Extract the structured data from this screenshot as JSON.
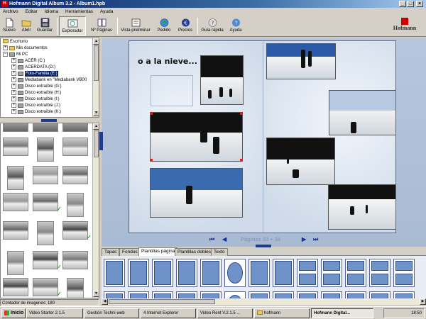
{
  "window": {
    "title": "Hofmann Digital Album 3.2 - Album1.hpb",
    "min": "_",
    "max": "□",
    "close": "×"
  },
  "menu": [
    "Archivo",
    "Editar",
    "Idioma",
    "Herramientas",
    "Ayuda"
  ],
  "toolbar": {
    "nuevo": "Nuevo",
    "abrir": "Abrir",
    "guardar": "Guardar",
    "explorador": "Explorador",
    "paginas": "Nº Páginas",
    "vista": "Vista preliminar",
    "pedido": "Pedido",
    "precios": "Precios",
    "guia": "Guía rápida",
    "ayuda": "Ayuda"
  },
  "logo": {
    "text": "Hofmann",
    "color": "#cc0000"
  },
  "tree": {
    "root": "Escritorio",
    "docs": "Mis documentos",
    "pc": "Mi PC",
    "items": [
      "ACER (C:)",
      "ACERDATA (D:)",
      "Foto-Familia (E:)",
      "Mediabank en \"Mediabank VB00",
      "Disco extraíble (G:)",
      "Disco extraíble (H:)",
      "Disco extraíble (I:)",
      "Disco extraíble (J:)",
      "Disco extraíble (K:)"
    ],
    "selected": "Foto-Familia (E:)"
  },
  "status": {
    "count_label": "Contador de imagenes: 180"
  },
  "album": {
    "caption": "o a la nieve..."
  },
  "pager": {
    "first": "⏮",
    "prev": "◀",
    "label": "Páginas 33 + 34",
    "next": "▶",
    "last": "⏭"
  },
  "tabs": [
    "Tapas",
    "Fondos",
    "Plantillas página",
    "Plantillas dobles",
    "Texto"
  ],
  "active_tab": "Plantillas página",
  "taskbar": {
    "start": "Inicio",
    "items": [
      "Video Starter 2.1.5",
      "Gestión Techni-web",
      "4 Internet Explorer",
      "Video Rent V.2.1.5 ...",
      "hofmann",
      "Hofmann Digital..."
    ],
    "active": "Hofmann Digital...",
    "clock": "18:50"
  },
  "colors": {
    "accent": "#0a246a",
    "album_bg": "#b7c6dc",
    "logo_red": "#cc0000"
  }
}
